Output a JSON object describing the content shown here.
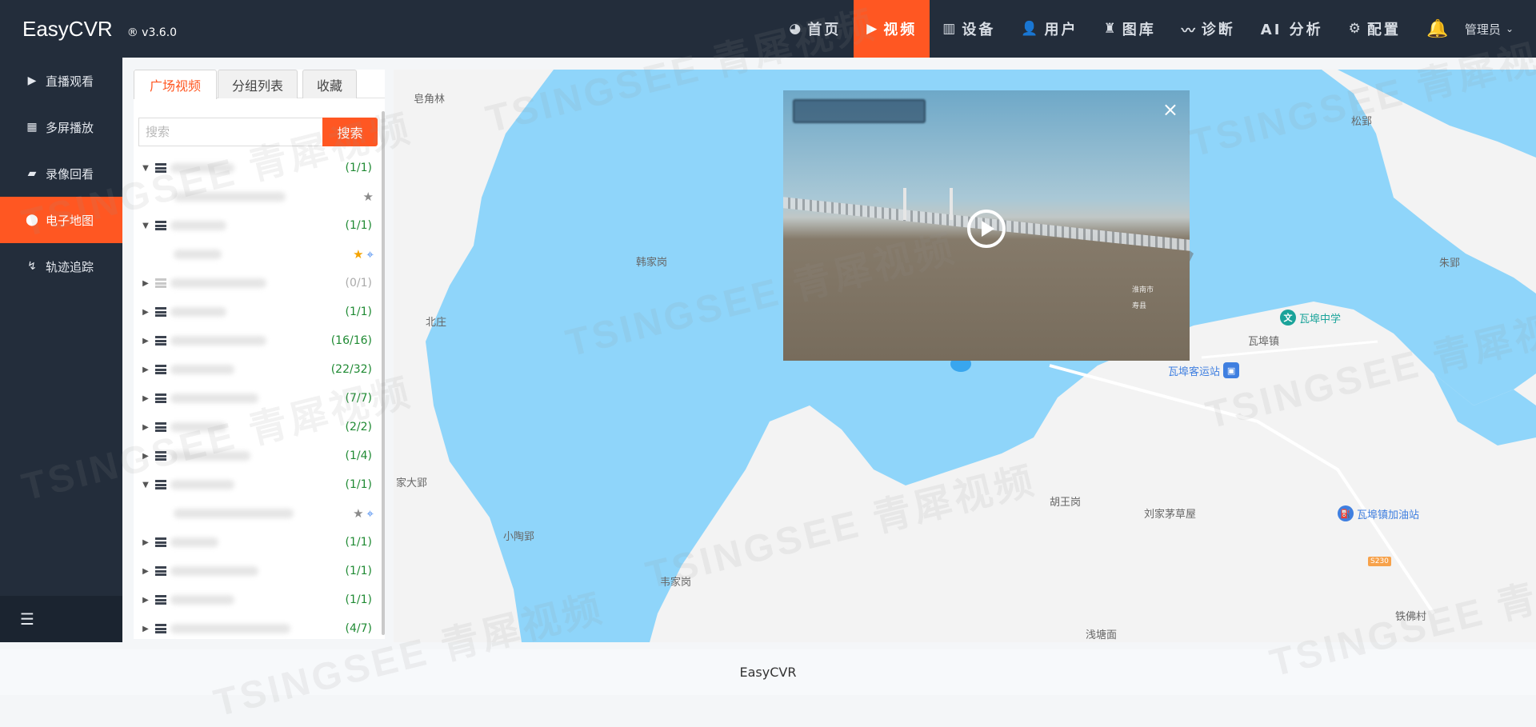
{
  "app": {
    "name": "EasyCVR",
    "version": "® v3.6.0"
  },
  "nav": [
    {
      "icon": "dashboard-icon",
      "glyph": "◕",
      "label": "首页",
      "active": false
    },
    {
      "icon": "play-icon",
      "glyph": "▶",
      "label": "视频",
      "active": true
    },
    {
      "icon": "device-icon",
      "glyph": "▥",
      "label": "设备",
      "active": false
    },
    {
      "icon": "user-icon",
      "glyph": "👤",
      "label": "用户",
      "active": false
    },
    {
      "icon": "gallery-icon",
      "glyph": "♜",
      "label": "图库",
      "active": false
    },
    {
      "icon": "pulse-icon",
      "glyph": "〰",
      "label": "诊断",
      "active": false
    },
    {
      "icon": "",
      "glyph": "",
      "label": "AI 分析",
      "active": false
    },
    {
      "icon": "gear-icon",
      "glyph": "⚙",
      "label": "配置",
      "active": false
    }
  ],
  "user": {
    "name": "管理员"
  },
  "sidebar": [
    {
      "icon": "play-circle-icon",
      "glyph": "▶",
      "label": "直播观看",
      "active": false
    },
    {
      "icon": "layout-icon",
      "glyph": "▦",
      "label": "多屏播放",
      "active": false
    },
    {
      "icon": "camera-icon",
      "glyph": "▰",
      "label": "录像回看",
      "active": false
    },
    {
      "icon": "location-pin-icon",
      "glyph": "⬤",
      "label": "电子地图",
      "active": true
    },
    {
      "icon": "track-icon",
      "glyph": "↯",
      "label": "轨迹追踪",
      "active": false
    }
  ],
  "panel": {
    "tabs": [
      "广场视频",
      "分组列表",
      "收藏"
    ],
    "search_placeholder": "搜索",
    "search_button": "搜索",
    "tree": [
      {
        "type": "group",
        "expanded": true,
        "count": "(1/1)",
        "dim": false
      },
      {
        "type": "leaf",
        "star": "grey",
        "pin": false
      },
      {
        "type": "group",
        "expanded": true,
        "count": "(1/1)",
        "dim": false
      },
      {
        "type": "leaf",
        "star": "gold",
        "pin": true
      },
      {
        "type": "group",
        "expanded": false,
        "count": "(0/1)",
        "dim": true
      },
      {
        "type": "group",
        "expanded": false,
        "count": "(1/1)",
        "dim": false
      },
      {
        "type": "group",
        "expanded": false,
        "count": "(16/16)",
        "dim": false
      },
      {
        "type": "group",
        "expanded": false,
        "count": "(22/32)",
        "dim": false
      },
      {
        "type": "group",
        "expanded": false,
        "count": "(7/7)",
        "dim": false
      },
      {
        "type": "group",
        "expanded": false,
        "count": "(2/2)",
        "dim": false
      },
      {
        "type": "group",
        "expanded": false,
        "count": "(1/4)",
        "dim": false
      },
      {
        "type": "group",
        "expanded": true,
        "count": "(1/1)",
        "dim": false
      },
      {
        "type": "leaf",
        "star": "grey",
        "pin": true
      },
      {
        "type": "group",
        "expanded": false,
        "count": "(1/1)",
        "dim": false
      },
      {
        "type": "group",
        "expanded": false,
        "count": "(1/1)",
        "dim": false
      },
      {
        "type": "group",
        "expanded": false,
        "count": "(1/1)",
        "dim": false
      },
      {
        "type": "group",
        "expanded": false,
        "count": "(4/7)",
        "dim": false
      }
    ]
  },
  "map": {
    "labels": [
      "皂角林",
      "韩家岗",
      "北庄",
      "家大郢",
      "小陶郢",
      "韦家岗",
      "胡王岗",
      "刘家茅草屋",
      "浅塘面",
      "松郢",
      "朱郢",
      "瓦埠镇",
      "铁佛村"
    ],
    "pois": [
      {
        "name": "瓦埠中学",
        "icon": "school-icon",
        "glyph": "文",
        "color": "#1aa39a"
      },
      {
        "name": "瓦埠客运站",
        "icon": "bus-station-icon",
        "glyph": "▣",
        "color": "#3f7fe0"
      },
      {
        "name": "瓦埠镇加油站",
        "icon": "gas-station-icon",
        "glyph": "⛽",
        "color": "#3f7fe0"
      }
    ],
    "road_tag": "S230",
    "partial_label": "口"
  },
  "video": {
    "close_glyph": "×",
    "osd_lines": [
      "淮南市",
      "寿县"
    ]
  },
  "footer": {
    "text": "EasyCVR"
  },
  "watermark": "TSINGSEE 青犀视频",
  "colors": {
    "accent": "#ff5722",
    "dark": "#232d3b",
    "water": "#8fd5fa",
    "online_count": "#1f8a33"
  }
}
